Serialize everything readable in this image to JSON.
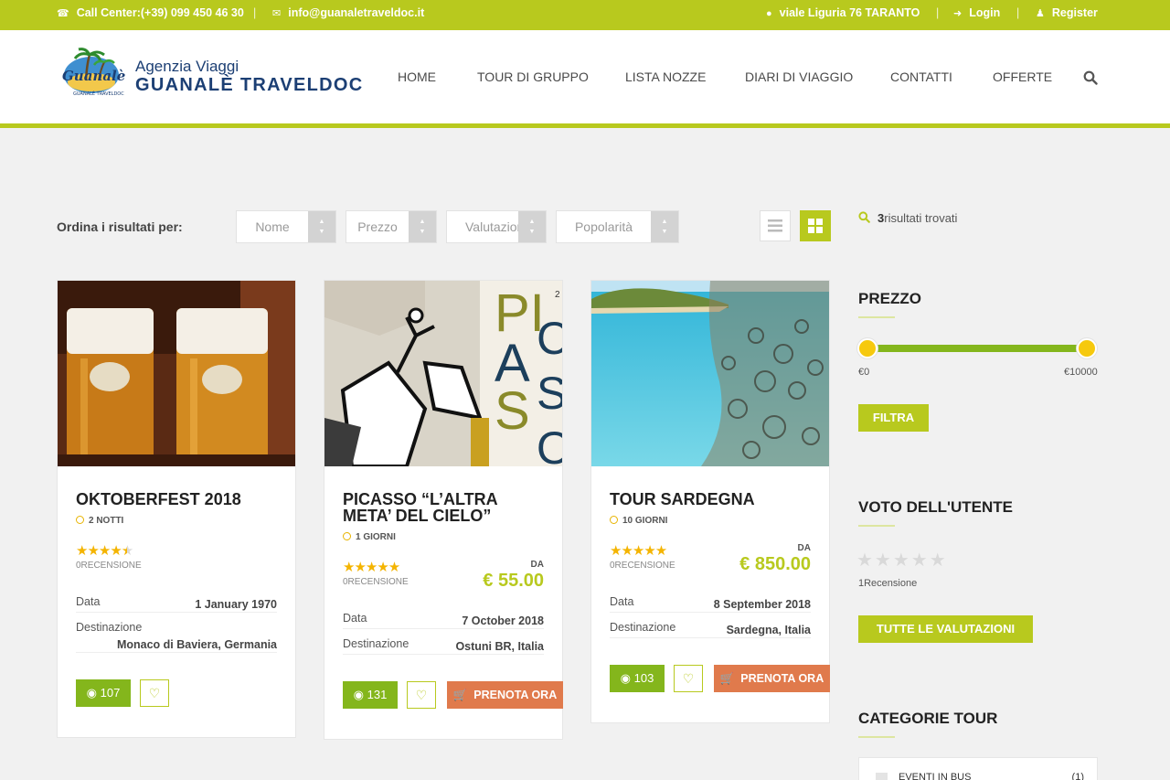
{
  "topbar": {
    "call_center": "Call Center:(+39) 099 450 46 30",
    "email": "info@guanaletraveldoc.it",
    "address": "viale Liguria 76 TARANTO",
    "login": "Login",
    "register": "Register",
    "separator": "|"
  },
  "brand": {
    "line1": "Agenzia Viaggi",
    "line2": "GUANALÈ TRAVELDOC",
    "mark_script": "Guanalè",
    "mark_sub": "GUANALÈ TRAVELDOC"
  },
  "nav": [
    "HOME",
    "TOUR DI GRUPPO",
    "LISTA NOZZE",
    "DIARI DI VIAGGIO",
    "CONTATTI",
    "OFFERTE"
  ],
  "sort": {
    "label": "Ordina i risultati per:",
    "options": [
      "Nome",
      "Prezzo",
      "Valutazione",
      "Popolarità"
    ]
  },
  "cards": [
    {
      "title": "OKTOBERFEST 2018",
      "duration": "2 NOTTI",
      "rating": 4.5,
      "stars": "★★★★★",
      "reviews": "0RECENSIONE",
      "price_prefix": "",
      "price": "",
      "date_label": "Data",
      "date": "1 January 1970",
      "dest_label": "Destinazione",
      "destination": "Monaco di Baviera, Germania",
      "views": "107",
      "book": ""
    },
    {
      "title": "PICASSO “L’ALTRA META’ DEL CIELO”",
      "duration": "1 GIORNI",
      "rating": 5,
      "stars": "★★★★★",
      "reviews": "0RECENSIONE",
      "price_prefix": "DA",
      "price": "€ 55.00",
      "date_label": "Data",
      "date": "7 October 2018",
      "dest_label": "Destinazione",
      "destination": "Ostuni BR, Italia",
      "views": "131",
      "book": "PRENOTA ORA"
    },
    {
      "title": "TOUR SARDEGNA",
      "duration": "10 GIORNI",
      "rating": 5,
      "stars": "★★★★★",
      "reviews": "0RECENSIONE",
      "price_prefix": "DA",
      "price": "€ 850.00",
      "date_label": "Data",
      "date": "8 September 2018",
      "dest_label": "Destinazione",
      "destination": "Sardegna, Italia",
      "views": "103",
      "book": "PRENOTA ORA"
    }
  ],
  "picasso_letters": [
    "PI",
    "CA",
    "A",
    "SS",
    "S",
    "O",
    "2"
  ],
  "sidebar": {
    "results_count": "3",
    "results_text": "risultati trovati",
    "price_heading": "PREZZO",
    "price_min": "€0",
    "price_max": "€10000",
    "slider_min": 0,
    "slider_max": 1,
    "filter_button": "FILTRA",
    "rating_heading": "VOTO DELL'UTENTE",
    "rating_stars": "★★★★★",
    "rating_count": "1Recensione",
    "all_ratings_button": "TUTTE LE VALUTAZIONI",
    "categories_heading": "CATEGORIE TOUR",
    "category_label": "EVENTI IN BUS",
    "category_count": "(1)"
  },
  "colors": {
    "accent": "#b8c91e",
    "green": "#84b61c",
    "orange": "#e07a4c",
    "star": "#f4b400",
    "navy": "#1c3f74"
  },
  "icons": {
    "phone": "headphones-icon",
    "email": "envelope-icon",
    "address": "map-marker-icon",
    "login": "sign-in-icon",
    "register": "user-icon",
    "search": "search-icon",
    "views": "eye-icon",
    "wishlist": "heart-icon",
    "book": "cart-icon",
    "duration": "clock-icon"
  }
}
